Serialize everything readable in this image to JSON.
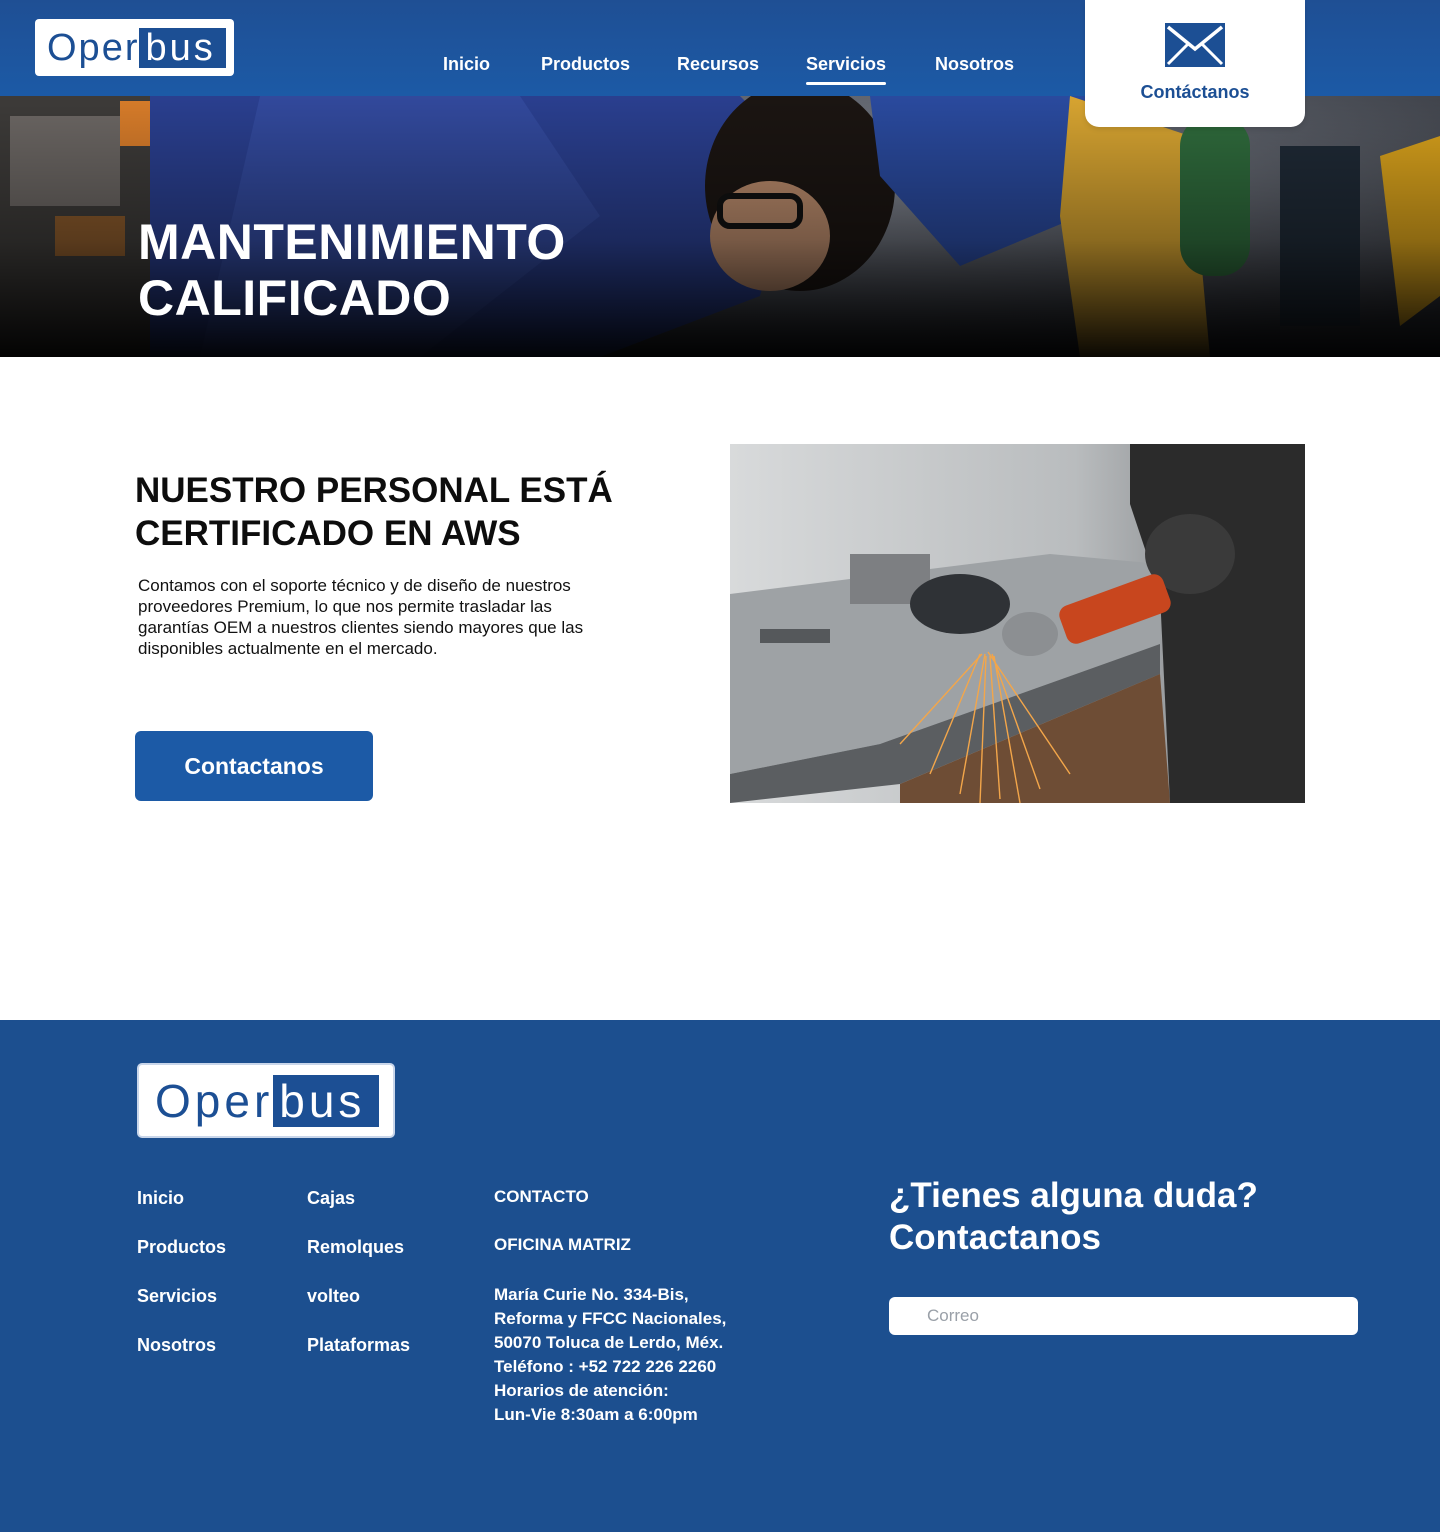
{
  "header": {
    "logo": {
      "part1": "Oper",
      "part2": "bus"
    },
    "nav": [
      {
        "label": "Inicio",
        "active": false
      },
      {
        "label": "Productos",
        "active": false
      },
      {
        "label": "Recursos",
        "active": false
      },
      {
        "label": "Servicios",
        "active": true
      },
      {
        "label": "Nosotros",
        "active": false
      }
    ],
    "contact_card": {
      "icon": "mail-icon",
      "label": "Contáctanos"
    }
  },
  "hero": {
    "title": "MANTENIMIENTO\nCALIFICADO"
  },
  "main": {
    "title": "NUESTRO PERSONAL ESTÁ\nCERTIFICADO EN AWS",
    "body": "Contamos con el soporte técnico y de diseño de nuestros proveedores Premium, lo que nos permite trasladar las garantías OEM a nuestros clientes siendo mayores que las disponibles actualmente en el mercado.",
    "button_label": "Contactanos"
  },
  "footer": {
    "logo": {
      "part1": "Oper",
      "part2": "bus"
    },
    "col1": [
      "Inicio",
      "Productos",
      "Servicios",
      "Nosotros"
    ],
    "col2": [
      "Cajas",
      "Remolques",
      "volteo",
      "Plataformas"
    ],
    "contact": {
      "heading": "CONTACTO",
      "office": "OFICINA MATRIZ",
      "address_lines": [
        "María Curie No. 334-Bis,",
        "Reforma y FFCC Nacionales,",
        "50070 Toluca de Lerdo, Méx.",
        "Teléfono : +52 722 226 2260",
        "Horarios de atención:",
        "Lun-Vie 8:30am a 6:00pm"
      ]
    },
    "question": "¿Tienes alguna duda?\nContactanos",
    "email_placeholder": "Correo"
  },
  "colors": {
    "brand_blue": "#1c4f94",
    "button_blue": "#1c5aa6",
    "footer_bg": "#1c4f8f"
  }
}
